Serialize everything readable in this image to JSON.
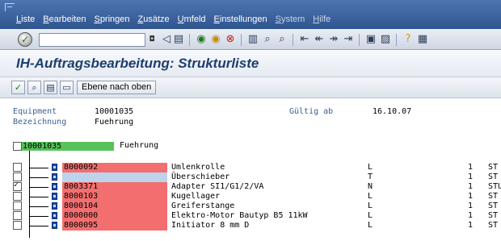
{
  "menu": {
    "items": [
      "Liste",
      "Bearbeiten",
      "Springen",
      "Zusätze",
      "Umfeld",
      "Einstellungen",
      "System",
      "Hilfe"
    ]
  },
  "toolbar": {
    "command_value": "",
    "icons": [
      "enter-icon",
      "save-icon",
      "back-icon",
      "exit-icon",
      "cancel-icon",
      "print-icon",
      "find-icon",
      "find-next-icon",
      "first-page-icon",
      "previous-page-icon",
      "next-page-icon",
      "last-page-icon",
      "create-session-icon",
      "shortcut-icon",
      "help-icon",
      "layout-icon"
    ]
  },
  "title": "IH-Auftragsbearbeitung: Strukturliste",
  "app_toolbar": {
    "level_up_label": "Ebene nach oben"
  },
  "header": {
    "equipment_label": "Equipment",
    "equipment_value": "10001035",
    "valid_from_label": "Gültig ab",
    "valid_from_value": "16.10.07",
    "description_label": "Bezeichnung",
    "description_value": "Fuehrung"
  },
  "tree": {
    "root": {
      "number": "10001035",
      "description": "Fuehrung",
      "checked": false
    },
    "items": [
      {
        "component": "8000092",
        "description": "Umlenkrolle",
        "category": "L",
        "quantity": "1",
        "unit": "ST",
        "checked": false,
        "highlight": "red"
      },
      {
        "component": "",
        "description": "Überschieber",
        "category": "T",
        "quantity": "1",
        "unit": "ST",
        "checked": false,
        "highlight": "blue"
      },
      {
        "component": "8003371",
        "description": "Adapter SI1/G1/2/VA",
        "category": "N",
        "quantity": "1",
        "unit": "STÜ",
        "checked": true,
        "highlight": "red"
      },
      {
        "component": "8000103",
        "description": "Kugellager",
        "category": "L",
        "quantity": "1",
        "unit": "ST",
        "checked": false,
        "highlight": "red"
      },
      {
        "component": "8000104",
        "description": "Greiferstange",
        "category": "L",
        "quantity": "1",
        "unit": "ST",
        "checked": false,
        "highlight": "red"
      },
      {
        "component": "8000000",
        "description": "Elektro-Motor Bautyp B5 11kW",
        "category": "L",
        "quantity": "1",
        "unit": "ST",
        "checked": false,
        "highlight": "red"
      },
      {
        "component": "8000095",
        "description": "Initiator 8 mm D",
        "category": "L",
        "quantity": "1",
        "unit": "ST",
        "checked": false,
        "highlight": "red"
      }
    ]
  },
  "colors": {
    "menubar": "#2f558f",
    "title_text": "#1d3e6f",
    "component_highlight": "#f36f6f",
    "root_highlight": "#56c25a",
    "blank_highlight": "#bcd3ec",
    "header_label": "#3b5f94"
  }
}
